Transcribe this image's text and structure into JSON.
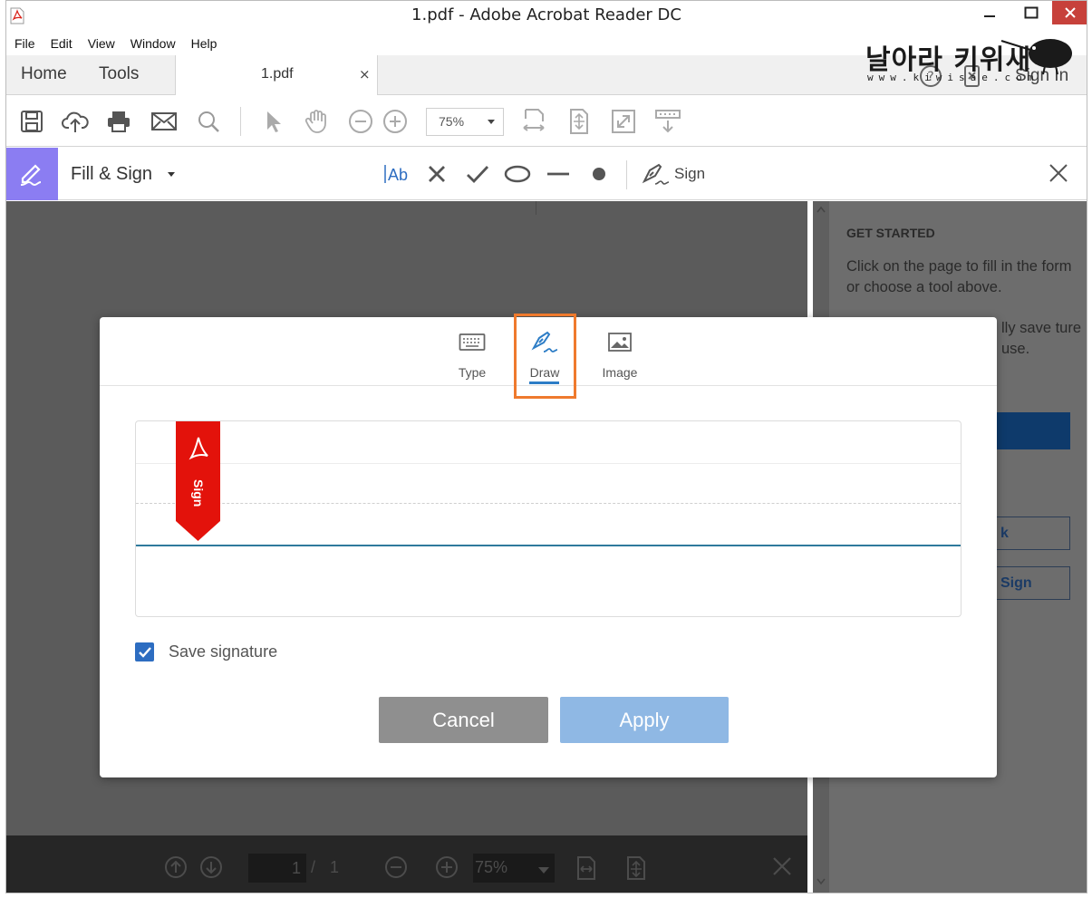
{
  "window": {
    "title": "1.pdf - Adobe Acrobat Reader DC",
    "close_color": "#c7413b"
  },
  "menu": [
    "File",
    "Edit",
    "View",
    "Window",
    "Help"
  ],
  "tabs": {
    "home": "Home",
    "tools": "Tools",
    "doc": "1.pdf",
    "doc_close": "×",
    "sign_in": "Sign In"
  },
  "watermark": {
    "korean": "날아라 키위새",
    "url": "www.kiwisae.com"
  },
  "toolbar": {
    "zoom": "75%",
    "icons": [
      "save-icon",
      "upload-icon",
      "print-icon",
      "mail-icon",
      "search-icon",
      "select-arrow-icon",
      "hand-icon",
      "zoom-out-icon",
      "zoom-in-icon",
      "fit-width-icon",
      "fit-page-icon",
      "full-screen-icon",
      "scroll-mode-icon"
    ]
  },
  "fill_sign": {
    "title": "Fill & Sign",
    "sign_label": "Sign",
    "accent": "#8b7df2"
  },
  "right_panel": {
    "heading": "GET STARTED",
    "text": "Click on the page to fill in the form or choose a tool above.",
    "partial_text": "lly save ture use.",
    "button1_partial": "k",
    "button2_partial": "Sign"
  },
  "bottom_bar": {
    "page": "1",
    "slash": "/",
    "total": "1",
    "zoom": "75%"
  },
  "dialog": {
    "tabs": [
      {
        "label": "Type",
        "icon": "keyboard-icon"
      },
      {
        "label": "Draw",
        "icon": "pen-icon"
      },
      {
        "label": "Image",
        "icon": "image-icon"
      }
    ],
    "active_tab": "Draw",
    "sign_flag_text": "Sign",
    "save_signature_label": "Save signature",
    "save_signature_checked": true,
    "cancel_label": "Cancel",
    "apply_label": "Apply",
    "highlight_color": "#ef7a2d",
    "apply_color": "#8fb8e4"
  }
}
